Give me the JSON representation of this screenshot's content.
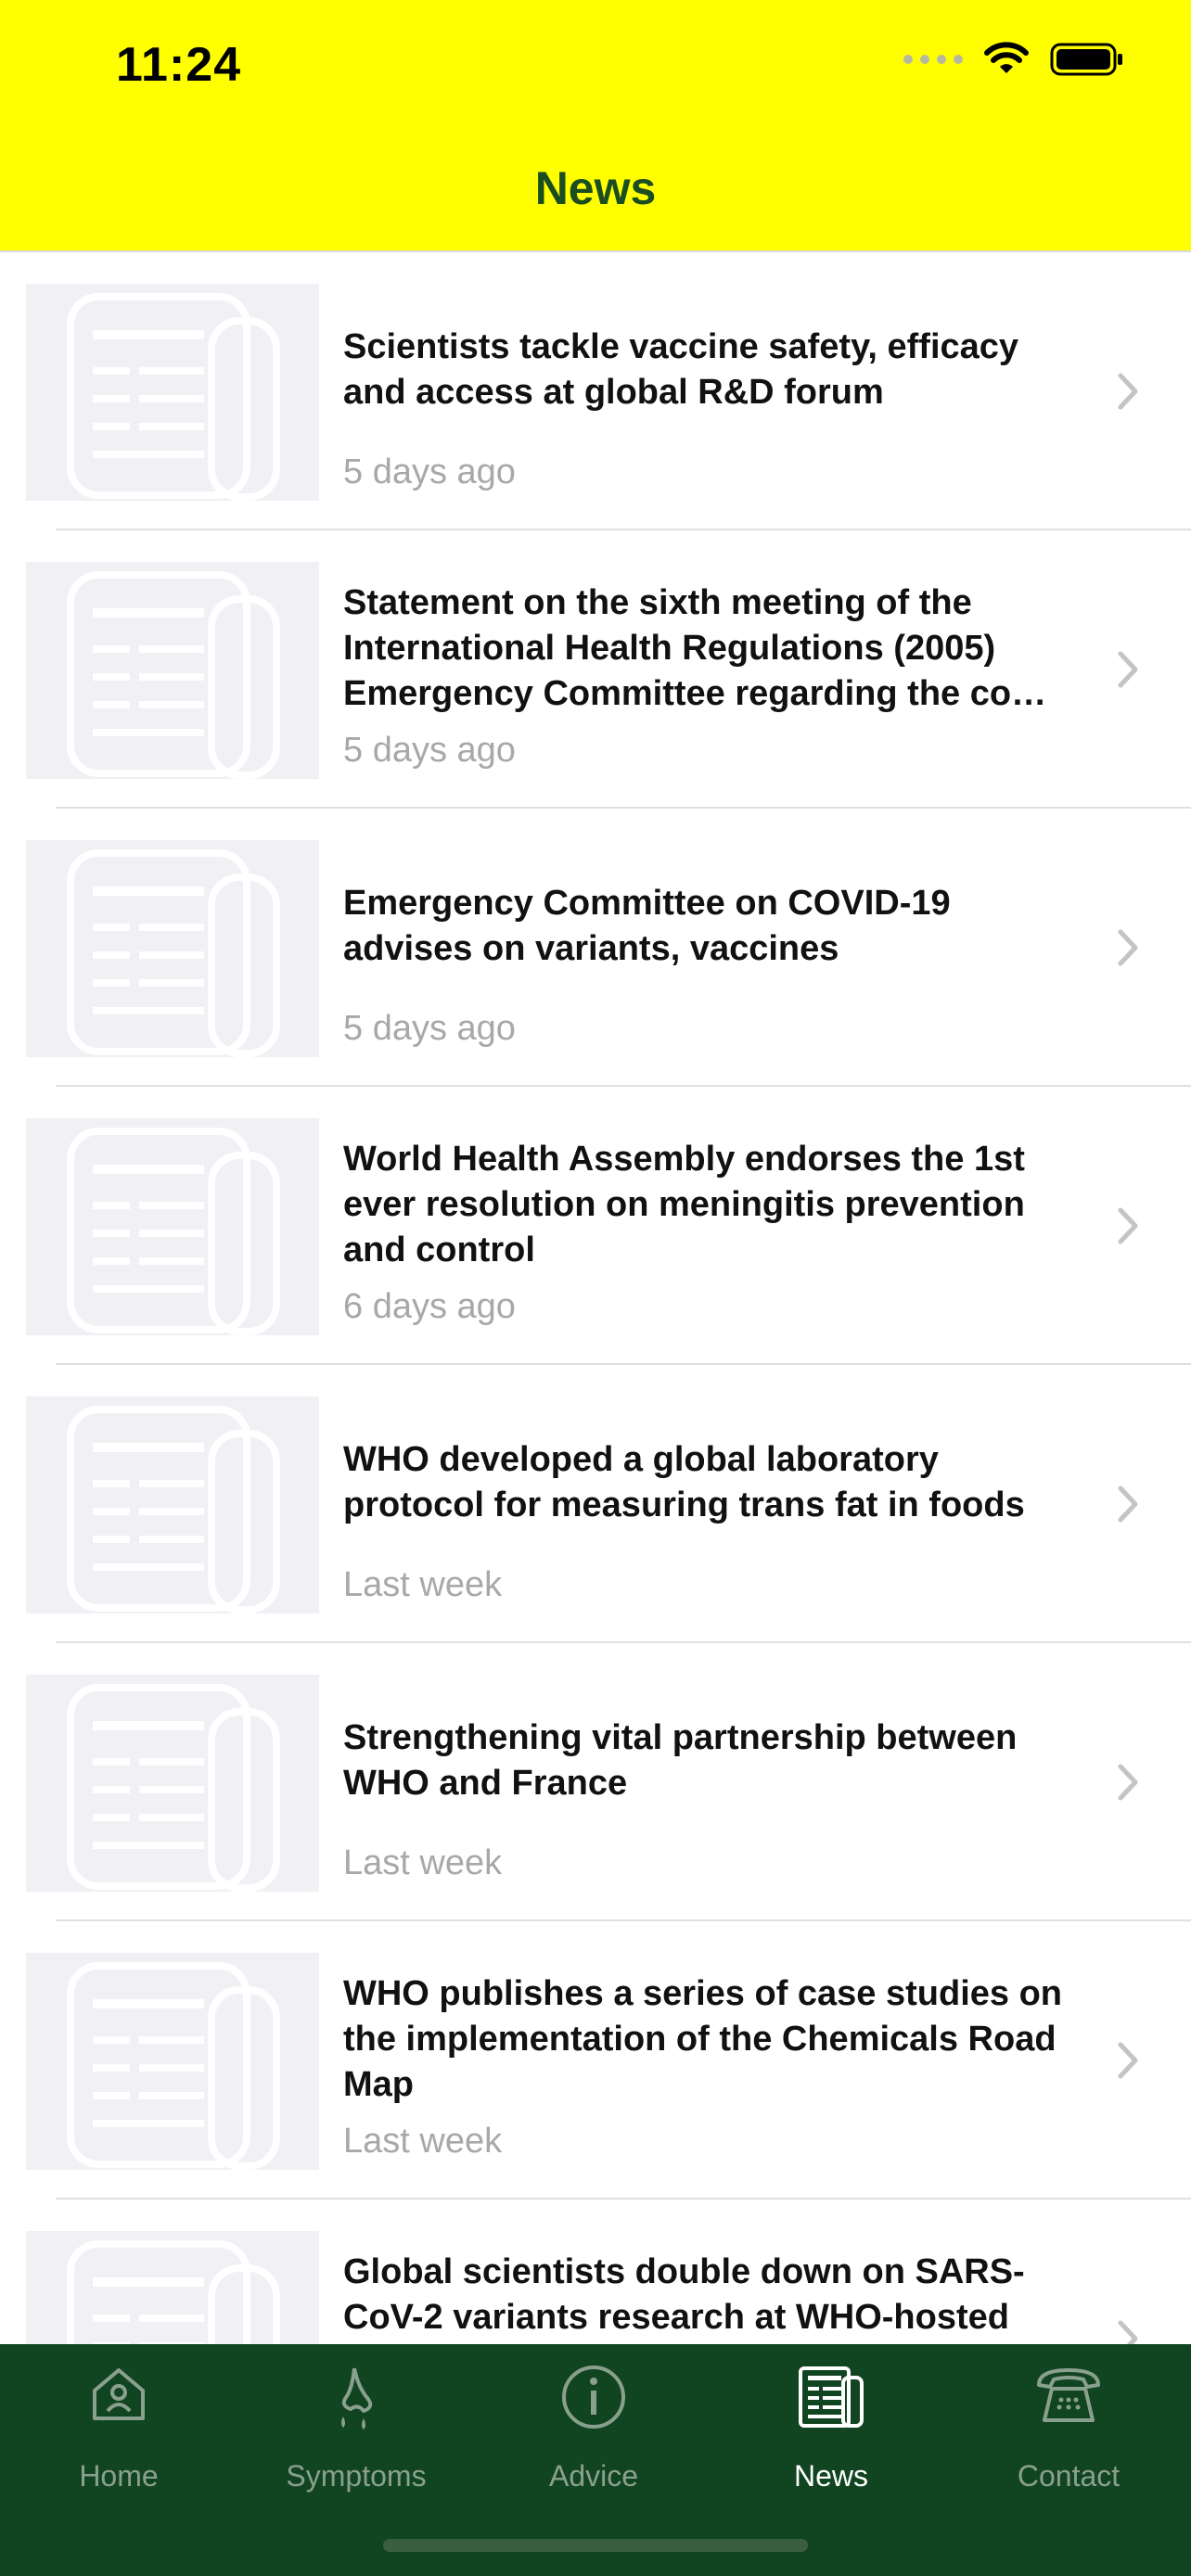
{
  "status_bar": {
    "time": "11:24"
  },
  "header": {
    "title": "News"
  },
  "articles": [
    {
      "title": "Scientists tackle vaccine safety, efficacy and access at global R&D forum",
      "time": "5 days ago"
    },
    {
      "title": "Statement on the sixth meeting of the International Health Regulations (2005) Emergency Committee regarding the co…",
      "time": "5 days ago"
    },
    {
      "title": "Emergency Committee on COVID-19 advises on variants, vaccines",
      "time": "5 days ago"
    },
    {
      "title": "World Health Assembly endorses the 1st ever resolution on meningitis prevention and control",
      "time": "6 days ago"
    },
    {
      "title": "WHO developed a global laboratory protocol for measuring trans fat in foods",
      "time": "Last week"
    },
    {
      "title": "Strengthening vital partnership between WHO and France",
      "time": "Last week"
    },
    {
      "title": "WHO publishes a series of case studies on the implementation of the Chemicals Road Map",
      "time": "Last week"
    },
    {
      "title": "Global scientists double down on SARS-CoV-2 variants research at WHO-hosted",
      "time": ""
    }
  ],
  "tab_bar": {
    "home": "Home",
    "symptoms": "Symptoms",
    "advice": "Advice",
    "news": "News",
    "contact": "Contact",
    "active": "news"
  },
  "colors": {
    "header_bg": "#ffff00",
    "title_color": "#1a4d20",
    "tabbar_bg": "#114420"
  }
}
